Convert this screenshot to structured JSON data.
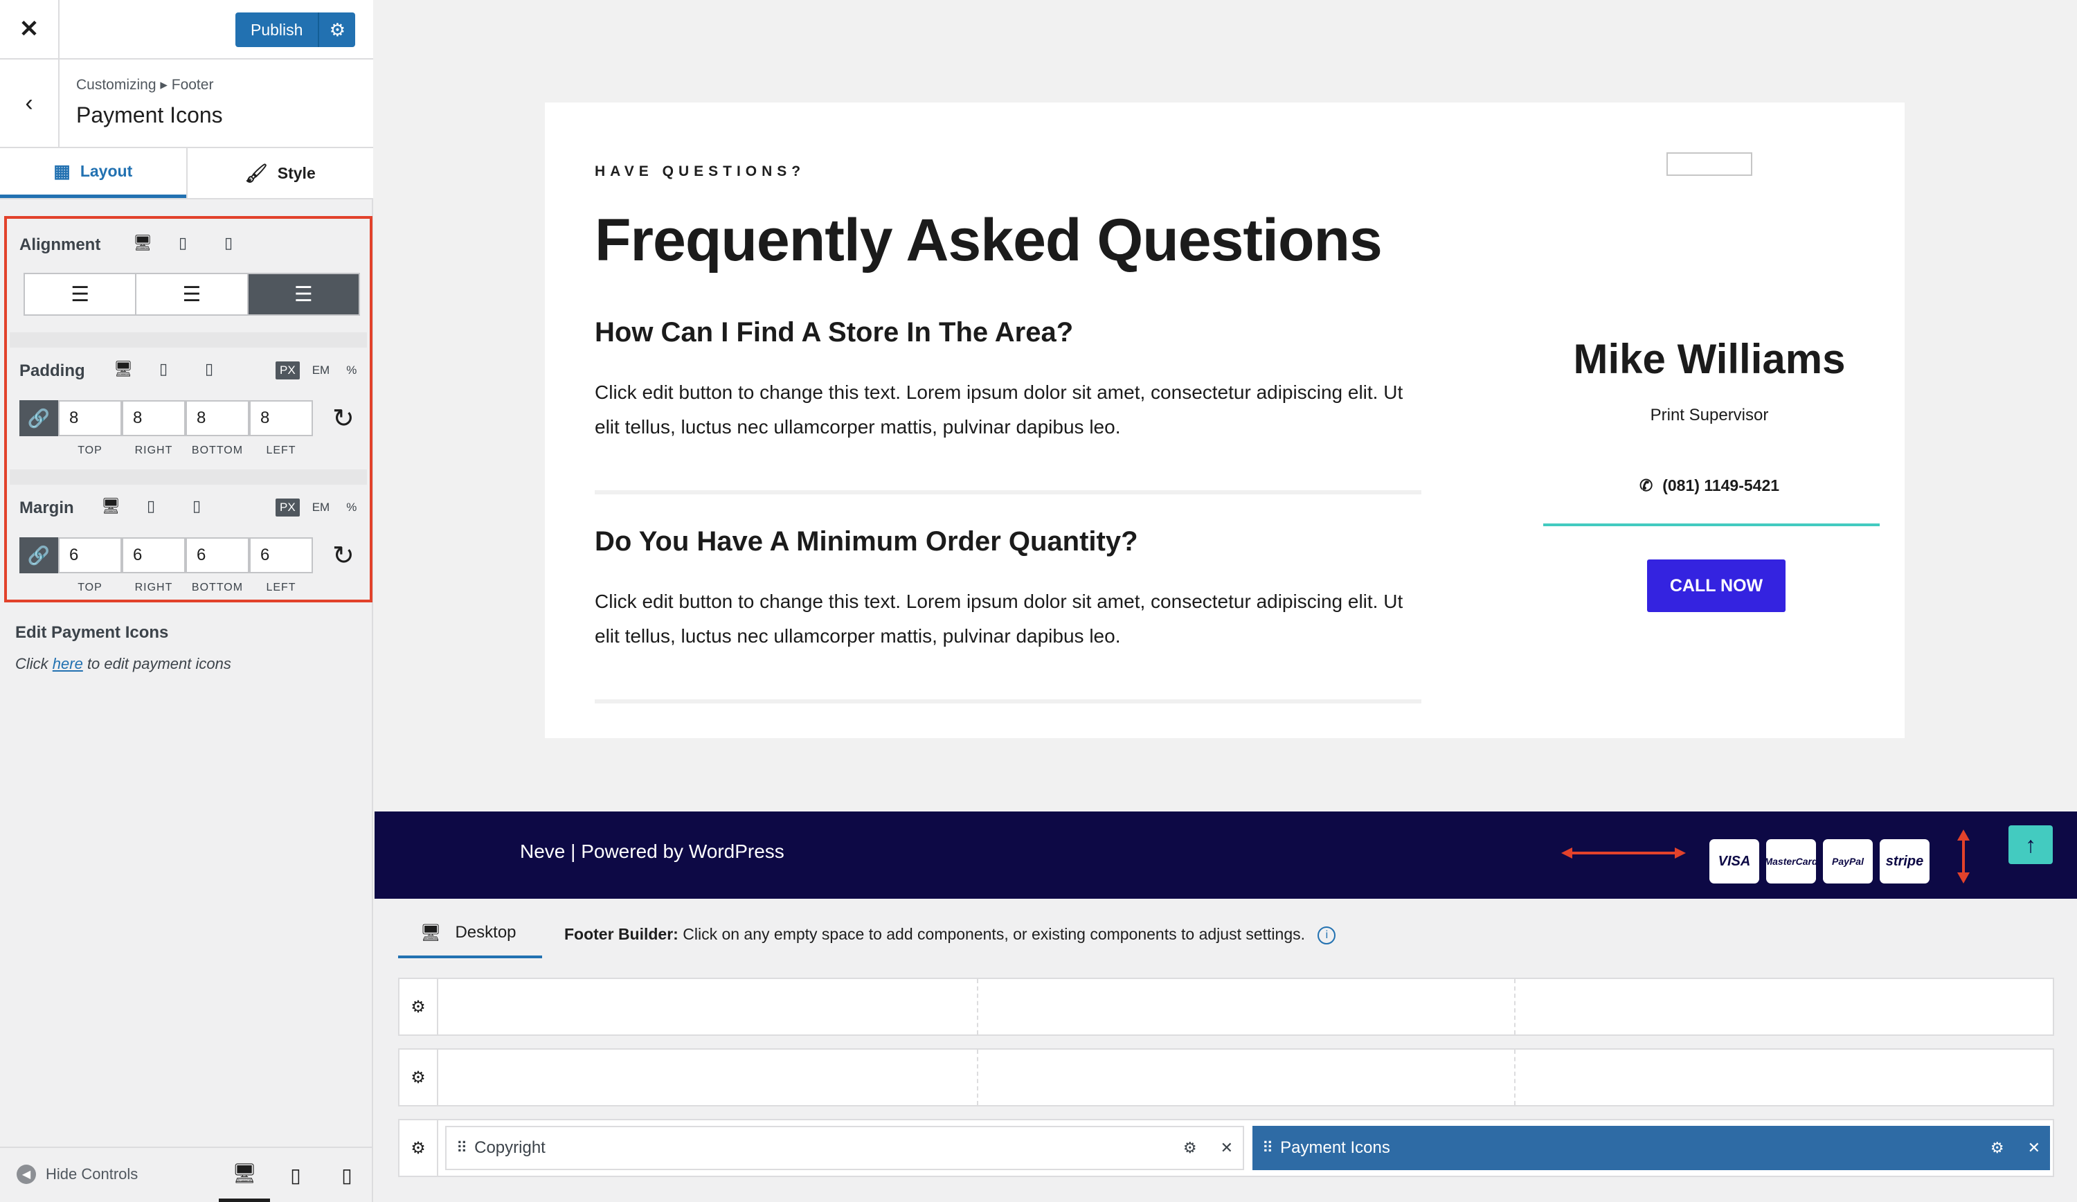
{
  "topbar": {
    "close_glyph": "✕",
    "publish_label": "Publish",
    "publish_settings_icon": "gear-icon"
  },
  "section": {
    "breadcrumb": "Customizing ▸ Footer",
    "title": "Payment Icons"
  },
  "tabs": [
    {
      "label": "Layout",
      "icon": "layout-icon",
      "active": true
    },
    {
      "label": "Style",
      "icon": "brush-icon",
      "active": false
    }
  ],
  "controls": {
    "alignment": {
      "label": "Alignment",
      "selected": "right"
    },
    "padding": {
      "label": "Padding",
      "unit_selected": "PX",
      "units": [
        "PX",
        "EM",
        "%"
      ],
      "values": [
        "8",
        "8",
        "8",
        "8"
      ],
      "sides": [
        "TOP",
        "RIGHT",
        "BOTTOM",
        "LEFT"
      ]
    },
    "margin": {
      "label": "Margin",
      "unit_selected": "PX",
      "units": [
        "PX",
        "EM",
        "%"
      ],
      "values": [
        "6",
        "6",
        "6",
        "6"
      ],
      "sides": [
        "TOP",
        "RIGHT",
        "BOTTOM",
        "LEFT"
      ]
    }
  },
  "edit_payment": {
    "title": "Edit Payment Icons",
    "prefix": "Click ",
    "link": "here",
    "suffix": " to edit payment icons"
  },
  "sidebar_footer": {
    "hide_controls": "Hide Controls",
    "active_device": "desktop"
  },
  "preview": {
    "eyebrow": "HAVE QUESTIONS?",
    "title": "Frequently Asked Questions",
    "faqs": [
      {
        "q": "How Can I Find A Store In The Area?",
        "a": "Click edit button to change this text. Lorem ipsum dolor sit amet, consectetur adipiscing elit. Ut elit tellus, luctus nec ullamcorper mattis, pulvinar dapibus leo."
      },
      {
        "q": "Do You Have A Minimum Order Quantity?",
        "a": "Click edit button to change this text. Lorem ipsum dolor sit amet, consectetur adipiscing elit. Ut elit tellus, luctus nec ullamcorper mattis, pulvinar dapibus leo."
      }
    ],
    "person": {
      "name": "Mike Williams",
      "role": "Print Supervisor",
      "phone": "(081) 1149-5421",
      "cta": "CALL NOW"
    },
    "footer_credit": "Neve | Powered by WordPress",
    "payment_cards": [
      "VISA",
      "MasterCard",
      "PayPal",
      "stripe"
    ]
  },
  "builder": {
    "device_tab": "Desktop",
    "info_label": "Footer Builder:",
    "info_text": "Click on any empty space to add components, or existing components to adjust settings.",
    "components": {
      "copyright": "Copyright",
      "payment_icons": "Payment Icons"
    }
  },
  "colors": {
    "accent": "#2271b1",
    "footer_bg": "#0d0945",
    "cta": "#3423e0",
    "teal": "#43cbc0",
    "highlight_box": "#e2422b"
  }
}
